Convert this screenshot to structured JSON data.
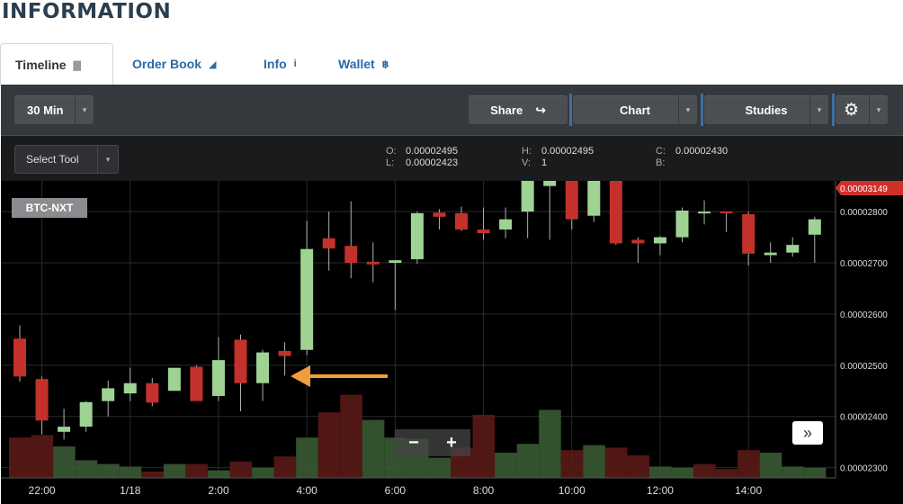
{
  "page_title": "INFORMATION",
  "tabs": [
    {
      "label": "Timeline",
      "icon": "bar-chart-icon"
    },
    {
      "label": "Order Book",
      "icon": "area-chart-icon"
    },
    {
      "label": "Info",
      "icon": "info-icon"
    },
    {
      "label": "Wallet",
      "icon": "bitcoin-icon"
    }
  ],
  "toolbar": {
    "interval": "30 Min",
    "share": "Share",
    "chart": "Chart",
    "studies": "Studies"
  },
  "select_tool": "Select Tool",
  "ohlc": {
    "o_label": "O:",
    "o": "0.00002495",
    "l_label": "L:",
    "l": "0.00002423",
    "h_label": "H:",
    "h": "0.00002495",
    "v_label": "V:",
    "v": "1",
    "c_label": "C:",
    "c": "0.00002430",
    "b_label": "B:",
    "b": ""
  },
  "chart_data": {
    "type": "candlestick",
    "symbol": "BTC-NXT",
    "last_price": "0.00003149",
    "y_ticks": [
      "0.00002800",
      "0.00002700",
      "0.00002600",
      "0.00002500",
      "0.00002400",
      "0.00002300"
    ],
    "ylim": [
      2.28e-05,
      2.86e-05
    ],
    "x_ticks": [
      {
        "label": "22:00",
        "i": 1
      },
      {
        "label": "1/18",
        "i": 5
      },
      {
        "label": "2:00",
        "i": 9
      },
      {
        "label": "4:00",
        "i": 13
      },
      {
        "label": "6:00",
        "i": 17
      },
      {
        "label": "8:00",
        "i": 21
      },
      {
        "label": "10:00",
        "i": 25
      },
      {
        "label": "12:00",
        "i": 29
      },
      {
        "label": "14:00",
        "i": 33
      }
    ],
    "candles": [
      {
        "o": 2.552,
        "h": 2.578,
        "l": 2.468,
        "c": 2.478
      },
      {
        "o": 2.473,
        "h": 2.478,
        "l": 2.365,
        "c": 2.392
      },
      {
        "o": 2.37,
        "h": 2.415,
        "l": 2.355,
        "c": 2.38
      },
      {
        "o": 2.38,
        "h": 2.43,
        "l": 2.37,
        "c": 2.428
      },
      {
        "o": 2.43,
        "h": 2.47,
        "l": 2.4,
        "c": 2.455
      },
      {
        "o": 2.445,
        "h": 2.495,
        "l": 2.43,
        "c": 2.465
      },
      {
        "o": 2.465,
        "h": 2.475,
        "l": 2.42,
        "c": 2.427
      },
      {
        "o": 2.45,
        "h": 2.495,
        "l": 2.45,
        "c": 2.495
      },
      {
        "o": 2.497,
        "h": 2.5,
        "l": 2.43,
        "c": 2.43
      },
      {
        "o": 2.44,
        "h": 2.555,
        "l": 2.43,
        "c": 2.51
      },
      {
        "o": 2.55,
        "h": 2.56,
        "l": 2.41,
        "c": 2.465
      },
      {
        "o": 2.465,
        "h": 2.53,
        "l": 2.43,
        "c": 2.525
      },
      {
        "o": 2.528,
        "h": 2.545,
        "l": 2.48,
        "c": 2.518
      },
      {
        "o": 2.53,
        "h": 2.782,
        "l": 2.52,
        "c": 2.727
      },
      {
        "o": 2.748,
        "h": 2.8,
        "l": 2.685,
        "c": 2.728
      },
      {
        "o": 2.733,
        "h": 2.82,
        "l": 2.67,
        "c": 2.7
      },
      {
        "o": 2.702,
        "h": 2.74,
        "l": 2.662,
        "c": 2.697
      },
      {
        "o": 2.7,
        "h": 2.7,
        "l": 2.608,
        "c": 2.705
      },
      {
        "o": 2.707,
        "h": 2.8,
        "l": 2.698,
        "c": 2.797
      },
      {
        "o": 2.798,
        "h": 2.805,
        "l": 2.765,
        "c": 2.79
      },
      {
        "o": 2.797,
        "h": 2.81,
        "l": 2.762,
        "c": 2.765
      },
      {
        "o": 2.765,
        "h": 2.808,
        "l": 2.745,
        "c": 2.758
      },
      {
        "o": 2.765,
        "h": 2.808,
        "l": 2.748,
        "c": 2.785
      },
      {
        "o": 2.8,
        "h": 2.86,
        "l": 2.748,
        "c": 2.86
      },
      {
        "o": 2.85,
        "h": 2.86,
        "l": 2.745,
        "c": 2.86
      },
      {
        "o": 2.86,
        "h": 2.86,
        "l": 2.765,
        "c": 2.785
      },
      {
        "o": 2.792,
        "h": 2.86,
        "l": 2.78,
        "c": 2.86
      },
      {
        "o": 2.86,
        "h": 2.86,
        "l": 2.735,
        "c": 2.738
      },
      {
        "o": 2.745,
        "h": 2.75,
        "l": 2.7,
        "c": 2.738
      },
      {
        "o": 2.738,
        "h": 2.752,
        "l": 2.715,
        "c": 2.75
      },
      {
        "o": 2.75,
        "h": 2.808,
        "l": 2.74,
        "c": 2.802
      },
      {
        "o": 2.8,
        "h": 2.822,
        "l": 2.775,
        "c": 2.8
      },
      {
        "o": 2.8,
        "h": 2.8,
        "l": 2.76,
        "c": 2.798
      },
      {
        "o": 2.795,
        "h": 2.8,
        "l": 2.695,
        "c": 2.718
      },
      {
        "o": 2.715,
        "h": 2.74,
        "l": 2.7,
        "c": 2.72
      },
      {
        "o": 2.72,
        "h": 2.75,
        "l": 2.712,
        "c": 2.735
      },
      {
        "o": 2.755,
        "h": 2.79,
        "l": 2.7,
        "c": 2.785
      }
    ],
    "volumes": [
      0.32,
      0.34,
      0.25,
      0.14,
      0.11,
      0.09,
      0.05,
      0.11,
      0.11,
      0.06,
      0.13,
      0.08,
      0.17,
      0.32,
      0.52,
      0.66,
      0.46,
      0.32,
      0.31,
      0.16,
      0.24,
      0.5,
      0.2,
      0.27,
      0.54,
      0.22,
      0.26,
      0.24,
      0.18,
      0.09,
      0.08,
      0.11,
      0.07,
      0.22,
      0.2,
      0.09,
      0.08
    ],
    "volume_up": [
      false,
      false,
      true,
      true,
      true,
      true,
      false,
      true,
      false,
      true,
      false,
      true,
      false,
      true,
      false,
      false,
      true,
      true,
      true,
      true,
      false,
      false,
      true,
      true,
      true,
      false,
      true,
      false,
      false,
      true,
      true,
      false,
      false,
      false,
      true,
      true,
      true
    ]
  },
  "colors": {
    "up": "#9ed394",
    "down": "#c3312a",
    "vol_up": "#3a5a34",
    "vol_down": "#5a1a17",
    "arrow": "#f39c3c",
    "price_tag": "#d0302a"
  }
}
